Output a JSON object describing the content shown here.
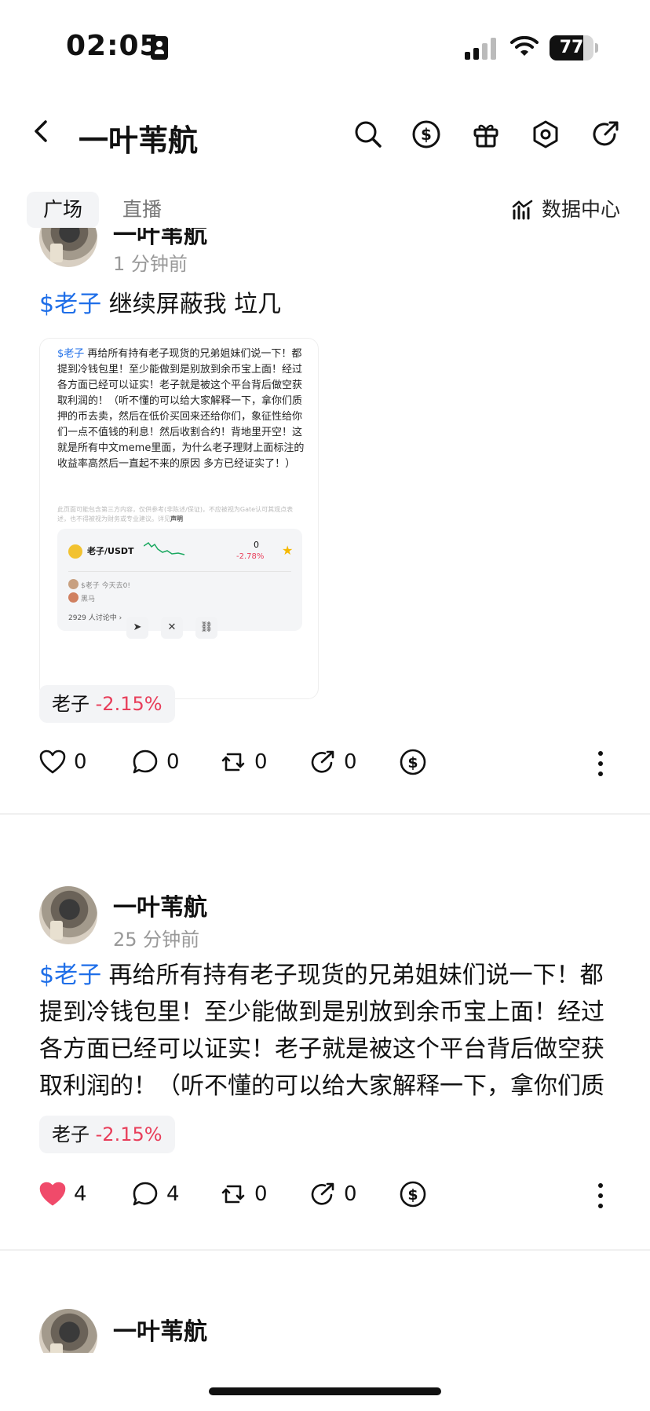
{
  "status_bar": {
    "time": "02:05",
    "battery": "77",
    "battery_level": 0.77
  },
  "header": {
    "title": "一叶苇航"
  },
  "tabs": {
    "active": "广场",
    "other": "直播",
    "data_center": "数据中心"
  },
  "posts": [
    {
      "username": "一叶苇航",
      "time": "1 分钟前",
      "cashtag": "$老子",
      "text": " 继续屏蔽我 垃几",
      "card": {
        "cashtag": "$老子",
        "text": " 再给所有持有老子现货的兄弟姐妹们说一下！都提到冷钱包里！至少能做到是别放到余币宝上面！经过各方面已经可以证实！老子就是被这个平台背后做空获取利润的！（听不懂的可以给大家解释一下，拿你们质押的币去卖，然后在低价买回来还给你们，象征性给你们一点不值钱的利息！然后收割合约！背地里开空！这就是所有中文meme里面，为什么老子理财上面标注的收益率高然后一直起不来的原因 多方已经证实了！）",
        "disclaimer": "此页面可能包含第三方内容，仅供参考(非陈述/保证)，不应被视为Gate认可其观点表述，也不得被视为财务或专业建议。详见",
        "disclaimer_link": "声明",
        "pair": "老子/USDT",
        "price": "0",
        "change": "-2.78%",
        "comments": [
          "$老子 今天去0!",
          "黑马"
        ],
        "discussion": "2929 人讨论中"
      },
      "tag_name": "老子",
      "tag_change": "-2.15%",
      "likes": "0",
      "comments": "0",
      "reposts": "0",
      "shares": "0",
      "liked": false
    },
    {
      "username": "一叶苇航",
      "time": "25 分钟前",
      "cashtag": "$老子",
      "text": " 再给所有持有老子现货的兄弟姐妹们说一下！都提到冷钱包里！至少能做到是别放到余币宝上面！经过各方面已经可以证实！老子就是被这个平台背后做空获取利润的！（听不懂的可以给大家解释一下，拿你们质押的币去卖，然后在低价买回来还给你们…",
      "tag_name": "老子",
      "tag_change": "-2.15%",
      "likes": "4",
      "comments": "4",
      "reposts": "0",
      "shares": "0",
      "liked": true
    },
    {
      "username": "一叶苇航"
    }
  ],
  "colors": {
    "accent_blue": "#1e6ee8",
    "negative": "#e83e5a",
    "like": "#f04a6a"
  }
}
